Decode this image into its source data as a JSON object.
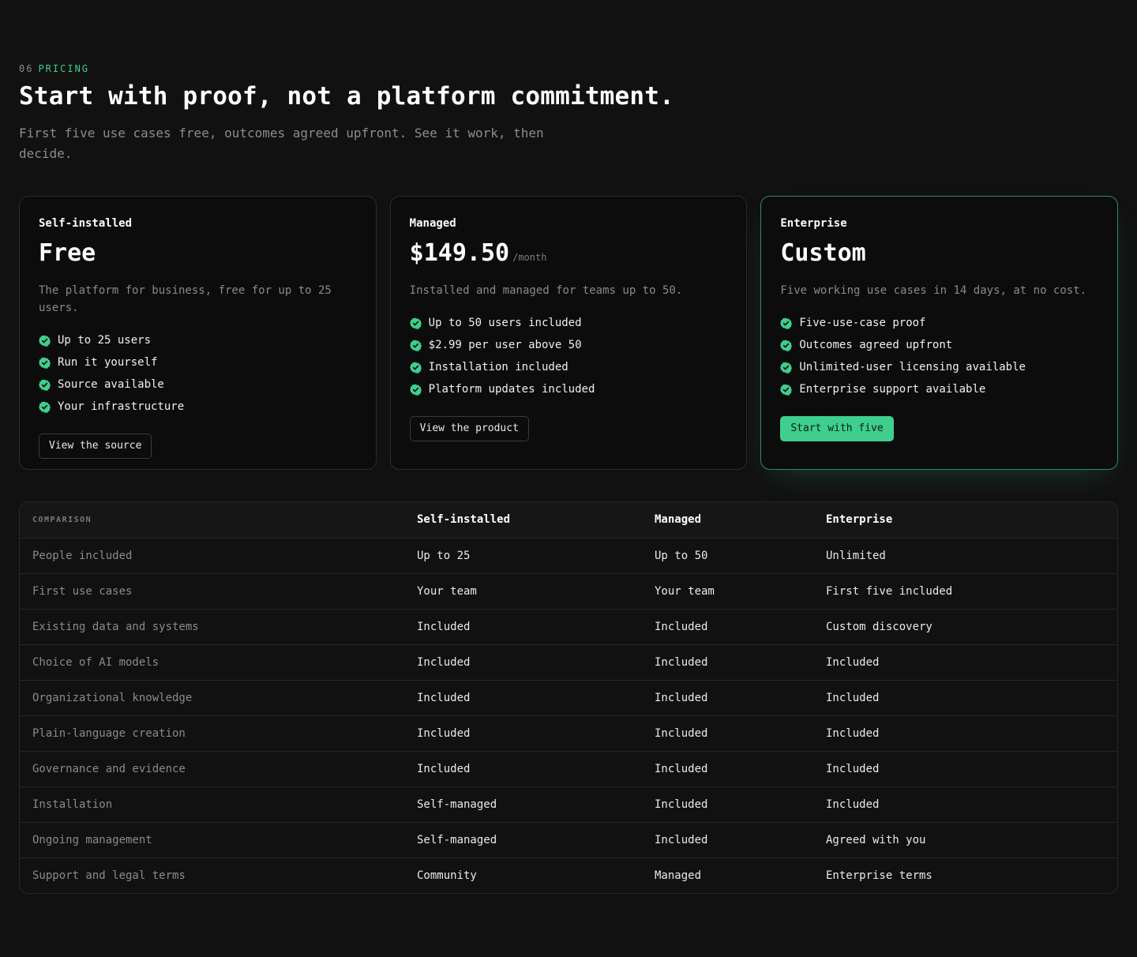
{
  "section": {
    "number": "06",
    "label": "PRICING",
    "title": "Start with proof, not a platform commitment.",
    "subtitle": "First five use cases free, outcomes agreed upfront. See it work, then decide."
  },
  "plans": [
    {
      "tier": "Self-installed",
      "price": "Free",
      "period": "",
      "description": "The platform for business, free for up to 25 users.",
      "features": [
        "Up to 25 users",
        "Run it yourself",
        "Source available",
        "Your infrastructure"
      ],
      "cta": "View the source"
    },
    {
      "tier": "Managed",
      "price": "$149.50",
      "period": "/month",
      "description": "Installed and managed for teams up to 50.",
      "features": [
        "Up to 50 users included",
        "$2.99 per user above 50",
        "Installation included",
        "Platform updates included"
      ],
      "cta": "View the product"
    },
    {
      "tier": "Enterprise",
      "price": "Custom",
      "period": "",
      "description": "Five working use cases in 14 days, at no cost.",
      "features": [
        "Five-use-case proof",
        "Outcomes agreed upfront",
        "Unlimited-user licensing available",
        "Enterprise support available"
      ],
      "cta": "Start with five"
    }
  ],
  "comparison": {
    "header": [
      "COMPARISON",
      "Self-installed",
      "Managed",
      "Enterprise"
    ],
    "rows": [
      [
        "People included",
        "Up to 25",
        "Up to 50",
        "Unlimited"
      ],
      [
        "First use cases",
        "Your team",
        "Your team",
        "First five included"
      ],
      [
        "Existing data and systems",
        "Included",
        "Included",
        "Custom discovery"
      ],
      [
        "Choice of AI models",
        "Included",
        "Included",
        "Included"
      ],
      [
        "Organizational knowledge",
        "Included",
        "Included",
        "Included"
      ],
      [
        "Plain-language creation",
        "Included",
        "Included",
        "Included"
      ],
      [
        "Governance and evidence",
        "Included",
        "Included",
        "Included"
      ],
      [
        "Installation",
        "Self-managed",
        "Included",
        "Included"
      ],
      [
        "Ongoing management",
        "Self-managed",
        "Included",
        "Agreed with you"
      ],
      [
        "Support and legal terms",
        "Community",
        "Managed",
        "Enterprise terms"
      ]
    ]
  },
  "colors": {
    "accent": "#3ecf8e",
    "background": "#111111",
    "card": "#0c0c0c",
    "border": "#2a2a2a"
  },
  "icons": {
    "feature": "check-badge-icon"
  }
}
